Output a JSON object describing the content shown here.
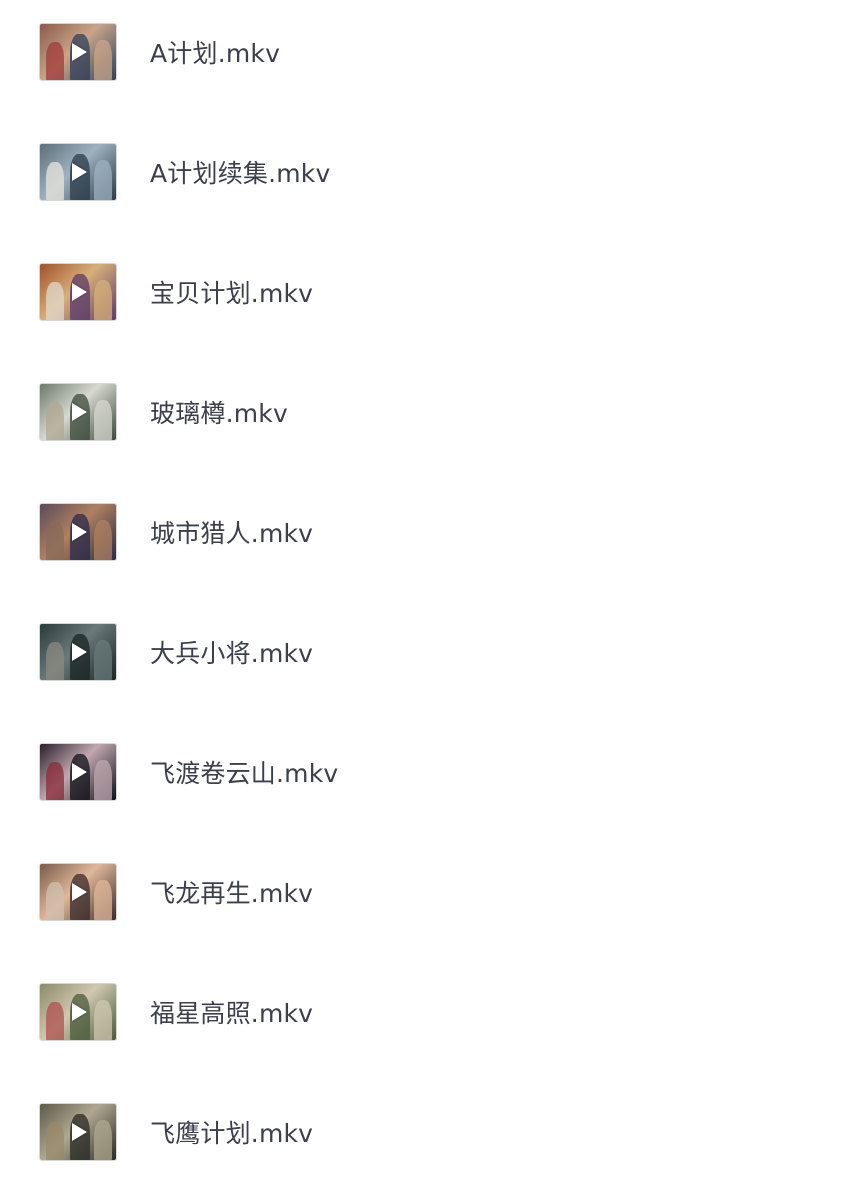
{
  "files": [
    {
      "name": "A计划.mkv",
      "thumb": [
        "#8b5a4a",
        "#c9a58a",
        "#2f3f5a",
        "#a23a3a"
      ]
    },
    {
      "name": "A计划续集.mkv",
      "thumb": [
        "#5d6e78",
        "#9fb2c0",
        "#2a3a48",
        "#e8e4dc"
      ]
    },
    {
      "name": "宝贝计划.mkv",
      "thumb": [
        "#a0502a",
        "#d8b07a",
        "#5a3a6a",
        "#e0d8cc"
      ]
    },
    {
      "name": "玻璃樽.mkv",
      "thumb": [
        "#6a7a6a",
        "#d8d8d0",
        "#3a4a3a",
        "#b0a890"
      ]
    },
    {
      "name": "城市猎人.mkv",
      "thumb": [
        "#5a4a5a",
        "#b08060",
        "#2a2a4a",
        "#8a6a5a"
      ]
    },
    {
      "name": "大兵小将.mkv",
      "thumb": [
        "#2a3a3a",
        "#6a7a7a",
        "#1a2424",
        "#8a8a80"
      ]
    },
    {
      "name": "飞渡卷云山.mkv",
      "thumb": [
        "#2a1e2a",
        "#c0a8b0",
        "#101018",
        "#8a2a3a"
      ]
    },
    {
      "name": "飞龙再生.mkv",
      "thumb": [
        "#7a5a4a",
        "#e0b89a",
        "#3a2a2a",
        "#d0c0b0"
      ]
    },
    {
      "name": "福星高照.mkv",
      "thumb": [
        "#8a8a6a",
        "#d0c8b0",
        "#4a5a3a",
        "#b05050"
      ]
    },
    {
      "name": "飞鹰计划.mkv",
      "thumb": [
        "#5a5a4a",
        "#b0a890",
        "#2a2a24",
        "#9a8a6a"
      ]
    }
  ],
  "colors": {
    "text": "#3c3f4c",
    "thumb_border": "#d6d6d6",
    "background": "#ffffff"
  },
  "icons": {
    "play": "play-icon"
  }
}
